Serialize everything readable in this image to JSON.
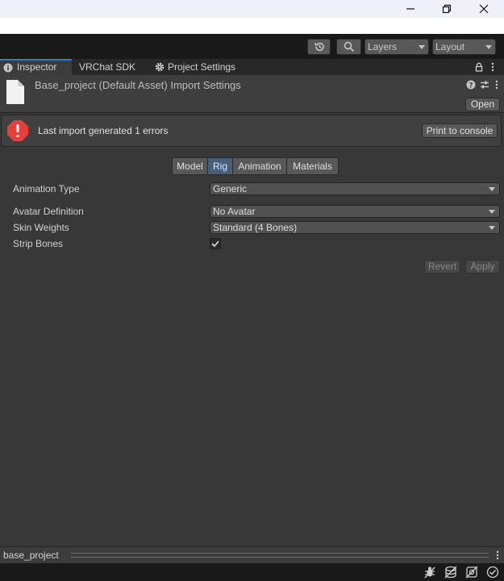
{
  "window_controls": {
    "minimize_icon": "minimize-icon",
    "restore_icon": "restore-icon",
    "close_icon": "close-icon"
  },
  "toolbar": {
    "history_icon": "history-icon",
    "search_icon": "search-icon",
    "layers_label": "Layers",
    "layout_label": "Layout"
  },
  "tabs": [
    {
      "label": "Inspector",
      "icon": "info-icon",
      "active": true
    },
    {
      "label": "VRChat SDK",
      "active": false
    },
    {
      "label": "Project Settings",
      "icon": "gear-icon",
      "active": false
    }
  ],
  "header": {
    "title": "Base_project (Default Asset) Import Settings",
    "open_label": "Open",
    "file_icon": "file-icon"
  },
  "error": {
    "message": "Last import generated 1 errors",
    "print_label": "Print to console",
    "color": "#e5403d"
  },
  "subtabs": [
    "Model",
    "Rig",
    "Animation",
    "Materials"
  ],
  "active_subtab": "Rig",
  "properties": {
    "animation_type": {
      "label": "Animation Type",
      "value": "Generic"
    },
    "avatar_definition": {
      "label": "Avatar Definition",
      "value": "No Avatar"
    },
    "skin_weights": {
      "label": "Skin Weights",
      "value": "Standard (4 Bones)"
    },
    "strip_bones": {
      "label": "Strip Bones",
      "checked": true
    }
  },
  "actions": {
    "revert_label": "Revert",
    "apply_label": "Apply"
  },
  "preview": {
    "name": "base_project"
  },
  "status_icons": [
    "bug-icon",
    "stack-icon",
    "network-off-icon",
    "check-circle-icon"
  ],
  "colors": {
    "accent": "#3a79bb",
    "active_subtab": "#46607c"
  }
}
